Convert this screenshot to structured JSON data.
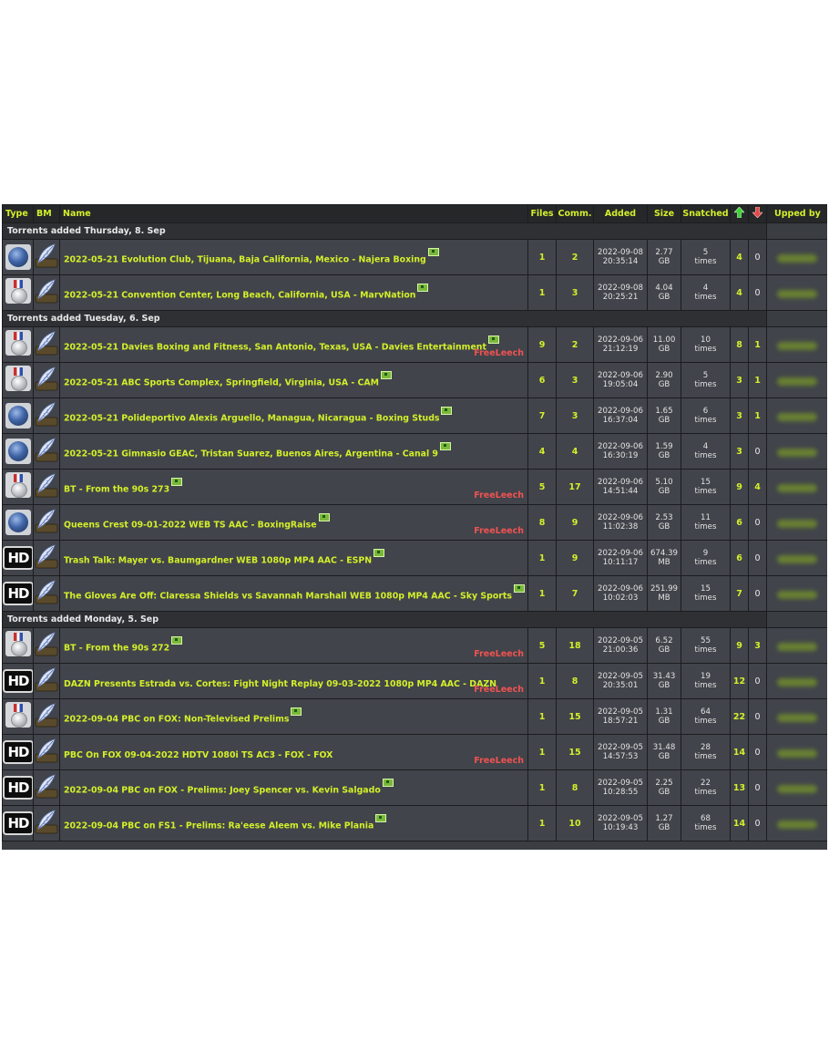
{
  "columns": {
    "type": "Type",
    "bm": "BM",
    "name": "Name",
    "files": "Files",
    "comm": "Comm.",
    "added": "Added",
    "size": "Size",
    "snatched": "Snatched",
    "seeders_icon": "arrow-up-icon",
    "leechers_icon": "arrow-down-icon",
    "upped_by": "Upped by"
  },
  "badges": {
    "freeleech": "FreeLeech",
    "nfo_icon": "nfo-icon"
  },
  "colors": {
    "accent": "#d3ef2a",
    "freeleech": "#f05252",
    "row_bg": "#41444a",
    "header_bg": "#262729"
  },
  "groups": [
    {
      "title": "Torrents added Thursday, 8. Sep",
      "rows": [
        {
          "type": "globe",
          "name": "2022-05-21 Evolution Club, Tijuana, Baja California, Mexico - Najera Boxing",
          "freeleech": false,
          "files": "1",
          "comments": "2",
          "date": "2022-09-08",
          "time": "20:35:14",
          "size": "2.77",
          "unit": "GB",
          "snatched": "5",
          "snatched_unit": "times",
          "seeders": "4",
          "leechers": "0"
        },
        {
          "type": "medal",
          "name": "2022-05-21 Convention Center, Long Beach, California, USA - MarvNation",
          "freeleech": false,
          "files": "1",
          "comments": "3",
          "date": "2022-09-08",
          "time": "20:25:21",
          "size": "4.04",
          "unit": "GB",
          "snatched": "4",
          "snatched_unit": "times",
          "seeders": "4",
          "leechers": "0"
        }
      ]
    },
    {
      "title": "Torrents added Tuesday, 6. Sep",
      "rows": [
        {
          "type": "medal",
          "name": "2022-05-21 Davies Boxing and Fitness, San Antonio, Texas, USA - Davies Entertainment",
          "freeleech": true,
          "files": "9",
          "comments": "2",
          "date": "2022-09-06",
          "time": "21:12:19",
          "size": "11.00",
          "unit": "GB",
          "snatched": "10",
          "snatched_unit": "times",
          "seeders": "8",
          "leechers": "1"
        },
        {
          "type": "medal",
          "name": "2022-05-21 ABC Sports Complex, Springfield, Virginia, USA - CAM",
          "freeleech": false,
          "files": "6",
          "comments": "3",
          "date": "2022-09-06",
          "time": "19:05:04",
          "size": "2.90",
          "unit": "GB",
          "snatched": "5",
          "snatched_unit": "times",
          "seeders": "3",
          "leechers": "1"
        },
        {
          "type": "globe",
          "name": "2022-05-21 Polideportivo Alexis Arguello, Managua, Nicaragua - Boxing Studs",
          "freeleech": false,
          "files": "7",
          "comments": "3",
          "date": "2022-09-06",
          "time": "16:37:04",
          "size": "1.65",
          "unit": "GB",
          "snatched": "6",
          "snatched_unit": "times",
          "seeders": "3",
          "leechers": "1"
        },
        {
          "type": "globe",
          "name": "2022-05-21 Gimnasio GEAC, Tristan Suarez, Buenos Aires, Argentina - Canal 9",
          "freeleech": false,
          "files": "4",
          "comments": "4",
          "date": "2022-09-06",
          "time": "16:30:19",
          "size": "1.59",
          "unit": "GB",
          "snatched": "4",
          "snatched_unit": "times",
          "seeders": "3",
          "leechers": "0"
        },
        {
          "type": "medal",
          "name": "BT - From the 90s 273",
          "freeleech": true,
          "files": "5",
          "comments": "17",
          "date": "2022-09-06",
          "time": "14:51:44",
          "size": "5.10",
          "unit": "GB",
          "snatched": "15",
          "snatched_unit": "times",
          "seeders": "9",
          "leechers": "4"
        },
        {
          "type": "globe",
          "name": "Queens Crest 09-01-2022 WEB TS AAC - BoxingRaise",
          "freeleech": true,
          "files": "8",
          "comments": "9",
          "date": "2022-09-06",
          "time": "11:02:38",
          "size": "2.53",
          "unit": "GB",
          "snatched": "11",
          "snatched_unit": "times",
          "seeders": "6",
          "leechers": "0"
        },
        {
          "type": "hd",
          "name": "Trash Talk: Mayer vs. Baumgardner WEB 1080p MP4 AAC - ESPN",
          "freeleech": false,
          "files": "1",
          "comments": "9",
          "date": "2022-09-06",
          "time": "10:11:17",
          "size": "674.39",
          "unit": "MB",
          "snatched": "9",
          "snatched_unit": "times",
          "seeders": "6",
          "leechers": "0"
        },
        {
          "type": "hd",
          "name": "The Gloves Are Off: Claressa Shields vs Savannah Marshall WEB 1080p MP4 AAC - Sky Sports",
          "freeleech": false,
          "files": "1",
          "comments": "7",
          "date": "2022-09-06",
          "time": "10:02:03",
          "size": "251.99",
          "unit": "MB",
          "snatched": "15",
          "snatched_unit": "times",
          "seeders": "7",
          "leechers": "0"
        }
      ]
    },
    {
      "title": "Torrents added Monday, 5. Sep",
      "rows": [
        {
          "type": "medal",
          "name": "BT - From the 90s 272",
          "freeleech": true,
          "files": "5",
          "comments": "18",
          "date": "2022-09-05",
          "time": "21:00:36",
          "size": "6.52",
          "unit": "GB",
          "snatched": "55",
          "snatched_unit": "times",
          "seeders": "9",
          "leechers": "3"
        },
        {
          "type": "hd",
          "name": "DAZN Presents Estrada vs. Cortes: Fight Night Replay 09-03-2022 1080p MP4 AAC - DAZN",
          "freeleech": true,
          "nfo": false,
          "files": "1",
          "comments": "8",
          "date": "2022-09-05",
          "time": "20:35:01",
          "size": "31.43",
          "unit": "GB",
          "snatched": "19",
          "snatched_unit": "times",
          "seeders": "12",
          "leechers": "0"
        },
        {
          "type": "medal",
          "name": "2022-09-04 PBC on FOX: Non-Televised Prelims",
          "freeleech": false,
          "files": "1",
          "comments": "15",
          "date": "2022-09-05",
          "time": "18:57:21",
          "size": "1.31",
          "unit": "GB",
          "snatched": "64",
          "snatched_unit": "times",
          "seeders": "22",
          "leechers": "0"
        },
        {
          "type": "hd",
          "name": "PBC On FOX 09-04-2022 HDTV 1080i TS AC3 - FOX - FOX",
          "freeleech": true,
          "nfo": false,
          "files": "1",
          "comments": "15",
          "date": "2022-09-05",
          "time": "14:57:53",
          "size": "31.48",
          "unit": "GB",
          "snatched": "28",
          "snatched_unit": "times",
          "seeders": "14",
          "leechers": "0"
        },
        {
          "type": "hd",
          "name": "2022-09-04 PBC on FOX - Prelims: Joey Spencer vs. Kevin Salgado",
          "freeleech": false,
          "files": "1",
          "comments": "8",
          "date": "2022-09-05",
          "time": "10:28:55",
          "size": "2.25",
          "unit": "GB",
          "snatched": "22",
          "snatched_unit": "times",
          "seeders": "13",
          "leechers": "0"
        },
        {
          "type": "hd",
          "name": "2022-09-04 PBC on FS1 - Prelims: Ra'eese Aleem vs. Mike Plania",
          "freeleech": false,
          "files": "1",
          "comments": "10",
          "date": "2022-09-05",
          "time": "10:19:43",
          "size": "1.27",
          "unit": "GB",
          "snatched": "68",
          "snatched_unit": "times",
          "seeders": "14",
          "leechers": "0"
        }
      ]
    }
  ]
}
